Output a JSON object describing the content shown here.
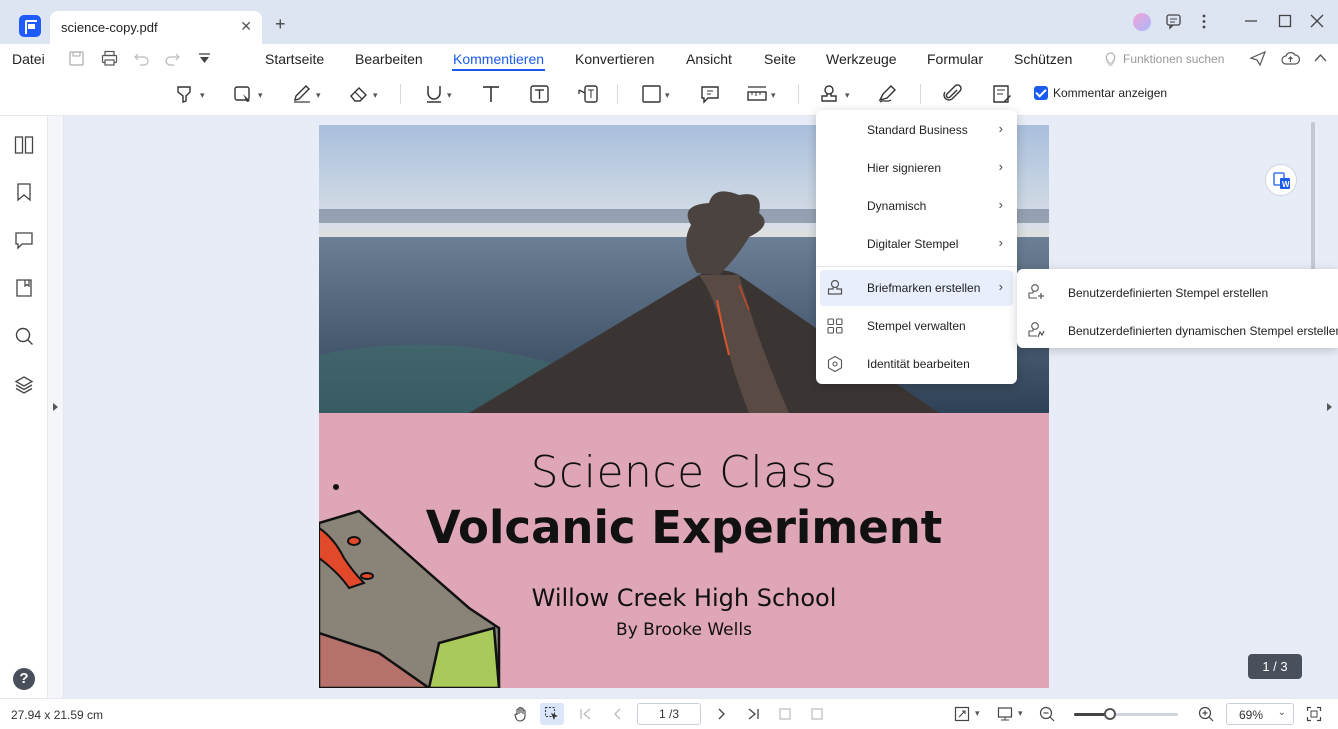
{
  "titlebar": {
    "tab_title": "science-copy.pdf",
    "tab_close": "✕",
    "new_tab": "+",
    "window_controls": [
      "minimize",
      "maximize",
      "close"
    ]
  },
  "menubar": {
    "file": "Datei",
    "items": [
      "Startseite",
      "Bearbeiten",
      "Kommentieren",
      "Konvertieren",
      "Ansicht",
      "Seite",
      "Werkzeuge",
      "Formular",
      "Schützen"
    ],
    "active": "Kommentieren",
    "search_features": "Funktionen suchen"
  },
  "toolbar": {
    "show_comments_label": "Kommentar anzeigen",
    "show_comments_checked": true
  },
  "document": {
    "title_line1": "Science Class",
    "title_line2": "Volcanic Experiment",
    "school": "Willow Creek High School",
    "author": "By Brooke Wells"
  },
  "stamp_menu": {
    "items": [
      {
        "label": "Standard Business",
        "has_submenu": true
      },
      {
        "label": "Hier signieren",
        "has_submenu": true
      },
      {
        "label": "Dynamisch",
        "has_submenu": true
      },
      {
        "label": "Digitaler Stempel",
        "has_submenu": true
      },
      {
        "label": "Briefmarken erstellen",
        "has_submenu": true,
        "icon": "stamp-icon"
      },
      {
        "label": "Stempel verwalten",
        "has_submenu": false,
        "icon": "grid-icon"
      },
      {
        "label": "Identität bearbeiten",
        "has_submenu": false,
        "icon": "hexagon-icon"
      }
    ],
    "arrow": "›"
  },
  "stamp_submenu": {
    "items": [
      {
        "label": "Benutzerdefinierten Stempel erstellen",
        "icon": "stamp-plus-icon"
      },
      {
        "label": "Benutzerdefinierten dynamischen Stempel erstellen",
        "icon": "stamp-dynamic-icon"
      }
    ]
  },
  "viewer": {
    "page_badge": "1 / 3",
    "help": "?"
  },
  "statusbar": {
    "page_size": "27.94 x 21.59 cm",
    "page_input": "1 /3",
    "zoom_value": "69%",
    "zoom_fraction": 0.35
  },
  "colors": {
    "accent": "#1a5cf0",
    "titlebar_bg": "#dde5f3",
    "canvas_bg": "#e8ecf6",
    "pink_panel": "#dfa6b7"
  }
}
